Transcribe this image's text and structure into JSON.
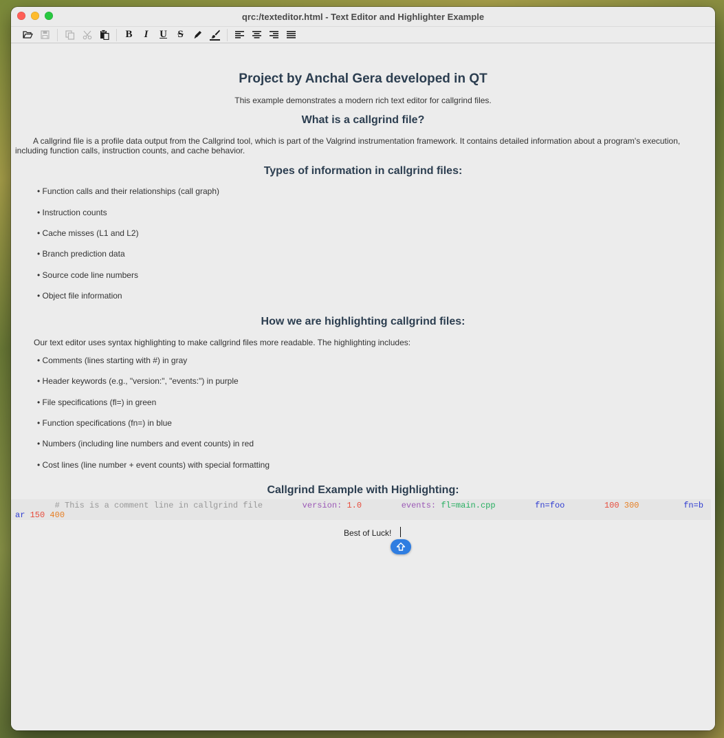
{
  "window": {
    "title": "qrc:/texteditor.html - Text Editor and Highlighter Example"
  },
  "toolbar": {
    "open": "folder-open-icon",
    "save": "save-icon",
    "copy": "copy-icon",
    "cut": "cut-icon",
    "paste": "paste-icon",
    "bold_label": "B",
    "italic_label": "I",
    "underline_label": "U",
    "strike_label": "S",
    "pen": "pen-icon",
    "brush": "brush-icon",
    "align_left": "align-left-icon",
    "align_center": "align-center-icon",
    "align_right": "align-right-icon",
    "align_justify": "align-justify-icon"
  },
  "doc": {
    "title": "Project by Anchal Gera developed in QT",
    "subtitle": "This example demonstrates a modern rich text editor for callgrind files.",
    "section1": {
      "heading": "What is a callgrind file?",
      "body": "A callgrind file is a profile data output from the Callgrind tool, which is part of the Valgrind instrumentation framework. It contains detailed information about a program's execution, including function calls, instruction counts, and cache behavior."
    },
    "section2": {
      "heading": "Types of information in callgrind files:",
      "items": [
        "• Function calls and their relationships (call graph)",
        "• Instruction counts",
        "• Cache misses (L1 and L2)",
        "• Branch prediction data",
        "• Source code line numbers",
        "• Object file information"
      ]
    },
    "section3": {
      "heading": "How we are highlighting callgrind files:",
      "intro": "Our text editor uses syntax highlighting to make callgrind files more readable. The highlighting includes:",
      "items": [
        "• Comments (lines starting with #) in gray",
        "• Header keywords (e.g., \"version:\", \"events:\") in purple",
        "• File specifications (fl=) in green",
        "• Function specifications (fn=) in blue",
        "• Numbers (including line numbers and event counts) in red",
        "• Cost lines (line number + event counts) with special formatting"
      ]
    },
    "section4": {
      "heading": "Callgrind Example with Highlighting:"
    },
    "code": {
      "comment": "# This is a comment line in callgrind file",
      "version_kw": "version:",
      "version_val": "1.0",
      "events_kw": "events:",
      "file_spec": "fl=main.cpp",
      "fn_foo": "fn=foo",
      "foo_line": "100",
      "foo_cost": "300",
      "fn_bar": "fn=bar",
      "bar_line": "150",
      "bar_cost": "400"
    },
    "closing": "Best of Luck!"
  },
  "colors": {
    "comment": "#999999",
    "keyword": "#9b59b6",
    "file": "#27ae60",
    "function": "#2e3bd1",
    "number": "#e74c3c",
    "cost": "#e67e22",
    "heading": "#2c3e50"
  },
  "floating_button": "scroll-up-icon"
}
